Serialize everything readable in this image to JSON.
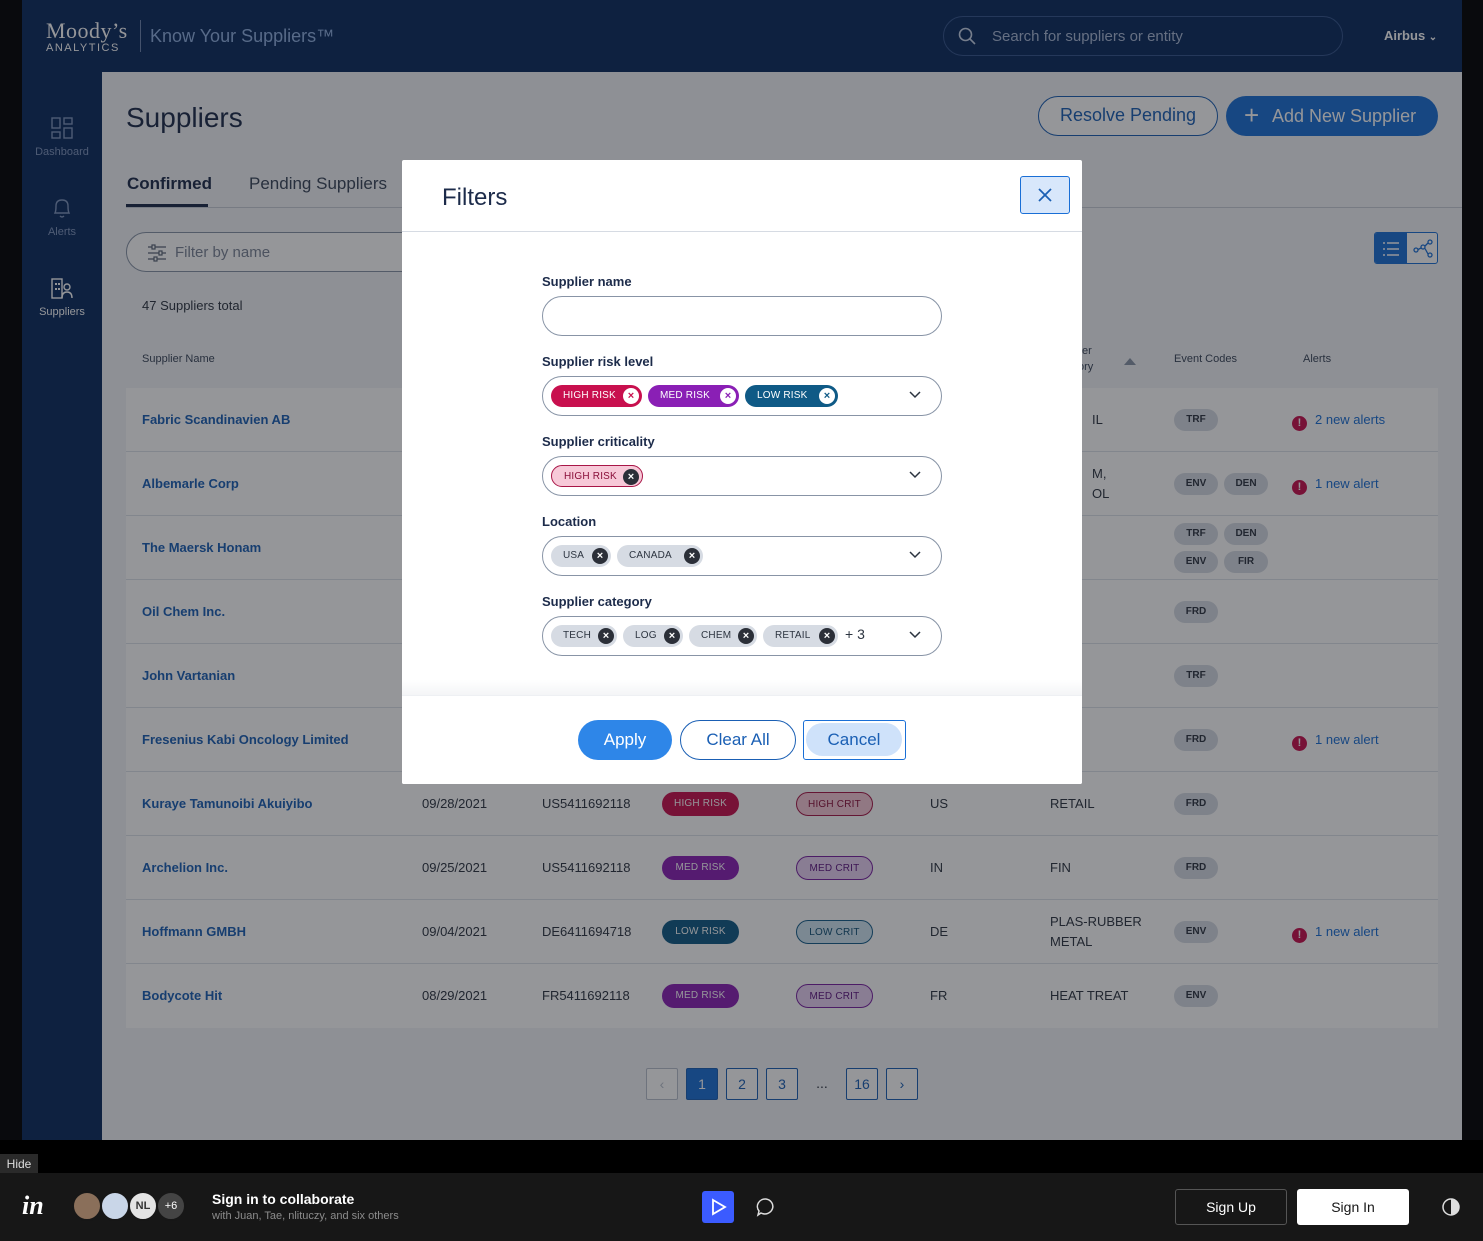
{
  "header": {
    "brand": "Moody’s",
    "brand_sub": "ANALYTICS",
    "product": "Know Your Suppliers™",
    "search_placeholder": "Search for suppliers or entity",
    "account": "Airbus"
  },
  "sidebar": {
    "items": [
      {
        "label": "Dashboard",
        "icon": "dashboard-icon"
      },
      {
        "label": "Alerts",
        "icon": "bell-icon"
      },
      {
        "label": "Suppliers",
        "icon": "buildings-icon"
      }
    ]
  },
  "page": {
    "title": "Suppliers",
    "resolve_label": "Resolve Pending",
    "add_label": "Add New Supplier"
  },
  "tabs": [
    {
      "label": "Confirmed"
    },
    {
      "label": "Pending Suppliers"
    }
  ],
  "filter": {
    "placeholder": "Filter by name"
  },
  "total": "47 Suppliers total",
  "columns": {
    "name": "Supplier Name",
    "category_a": "er",
    "category_b": "ory",
    "events": "Event Codes",
    "alerts": "Alerts"
  },
  "rows": [
    {
      "name": "Fabric Scandinavien AB",
      "category": "IL",
      "events": [
        "TRF"
      ],
      "alert": "2 new alerts"
    },
    {
      "name": "Albemarle Corp",
      "category_a": "M,",
      "category_b": "OL",
      "events": [
        "ENV",
        "DEN"
      ],
      "alert": "1 new alert"
    },
    {
      "name": "The Maersk Honam",
      "events": [
        "TRF",
        "DEN",
        "ENV",
        "FIR"
      ]
    },
    {
      "name": "Oil Chem Inc.",
      "events": [
        "FRD"
      ]
    },
    {
      "name": "John Vartanian",
      "events": [
        "TRF"
      ]
    },
    {
      "name": "Fresenius Kabi Oncology Limited",
      "events": [
        "FRD"
      ],
      "alert": "1 new alert"
    },
    {
      "name": "Kuraye Tamunoibi Akuiyibo",
      "date": "09/28/2021",
      "id": "US5411692118",
      "risk": "HIGH RISK",
      "crit": "HIGH CRIT",
      "loc": "US",
      "category": "RETAIL",
      "events": [
        "FRD"
      ]
    },
    {
      "name": "Archelion Inc.",
      "date": "09/25/2021",
      "id": "US5411692118",
      "risk": "MED RISK",
      "crit": "MED CRIT",
      "loc": "IN",
      "category": "FIN",
      "events": [
        "FRD"
      ]
    },
    {
      "name": "Hoffmann GMBH",
      "date": "09/04/2021",
      "id": "DE6411694718",
      "risk": "LOW RISK",
      "crit": "LOW CRIT",
      "loc": "DE",
      "category_a": "PLAS-RUBBER",
      "category_b": "METAL",
      "events": [
        "ENV"
      ],
      "alert": "1 new alert"
    },
    {
      "name": "Bodycote Hit",
      "date": "08/29/2021",
      "id": "FR5411692118",
      "risk": "MED RISK",
      "crit": "MED CRIT",
      "loc": "FR",
      "category": "HEAT TREAT",
      "events": [
        "ENV"
      ]
    }
  ],
  "pagination": [
    "1",
    "2",
    "3",
    "...",
    "16"
  ],
  "modal": {
    "title": "Filters",
    "supplier_name_label": "Supplier name",
    "supplier_name_value": "",
    "risk_label": "Supplier risk level",
    "risk_chips": [
      "HIGH RISK",
      "MED RISK",
      "LOW RISK"
    ],
    "criticality_label": "Supplier criticality",
    "criticality_chips": [
      "HIGH RISK"
    ],
    "location_label": "Location",
    "location_chips": [
      "USA",
      "CANADA"
    ],
    "category_label": "Supplier category",
    "category_chips": [
      "TECH",
      "LOG",
      "CHEM",
      "RETAIL"
    ],
    "category_more": "+ 3",
    "apply": "Apply",
    "clear": "Clear All",
    "cancel": "Cancel"
  },
  "bottom": {
    "hide": "Hide",
    "brand": "in",
    "avatar_initials": "NL",
    "avatar_more": "+6",
    "title": "Sign in to collaborate",
    "subtitle": "with Juan, Tae, nlituczy, and six others",
    "signup": "Sign Up",
    "signin": "Sign In"
  },
  "colors": {
    "navy": "#0a2a5e",
    "primary": "#1a6fd6",
    "high": "#c8104e",
    "med": "#8a1fb5",
    "low": "#0f5a86"
  }
}
